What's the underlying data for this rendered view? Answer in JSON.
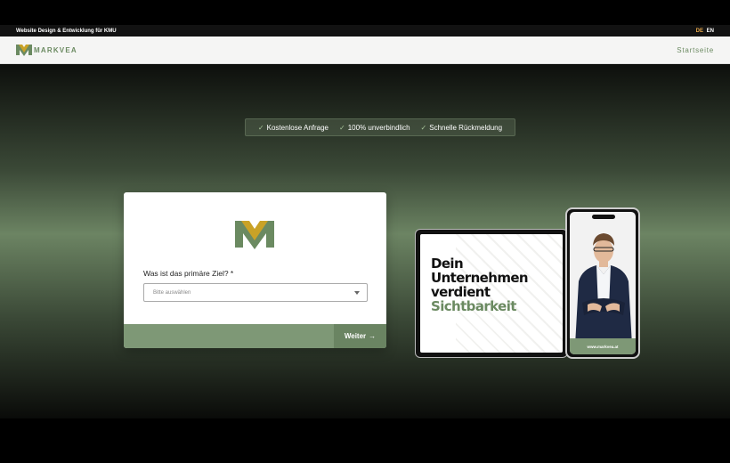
{
  "topbar": {
    "title": "Website Design & Entwicklung für KMU",
    "lang_de": "DE",
    "lang_en": "EN"
  },
  "nav": {
    "brand": "MARKVEA",
    "link": "Startseite"
  },
  "benefits": [
    {
      "icon": "check-icon",
      "check": "✓",
      "label": "Kostenlose Anfrage"
    },
    {
      "icon": "check-icon",
      "check": "✓",
      "label": "100% unverbindlich"
    },
    {
      "icon": "check-icon",
      "check": "✓",
      "label": "Schnelle Rückmeldung"
    }
  ],
  "form": {
    "question": "Was ist das primäre Ziel? *",
    "select_placeholder": "Bitte auswählen",
    "next_label": "Weiter",
    "next_arrow": "→"
  },
  "mockup": {
    "headline_1": "Dein",
    "headline_2": "Unternehmen",
    "headline_3": "verdient",
    "headline_accent": "Sichtbarkeit",
    "phone_url": "www.markvea.at"
  },
  "colors": {
    "accent": "#6b8a61",
    "button": "#6a8462",
    "lang_inactive": "#e9a94a"
  }
}
